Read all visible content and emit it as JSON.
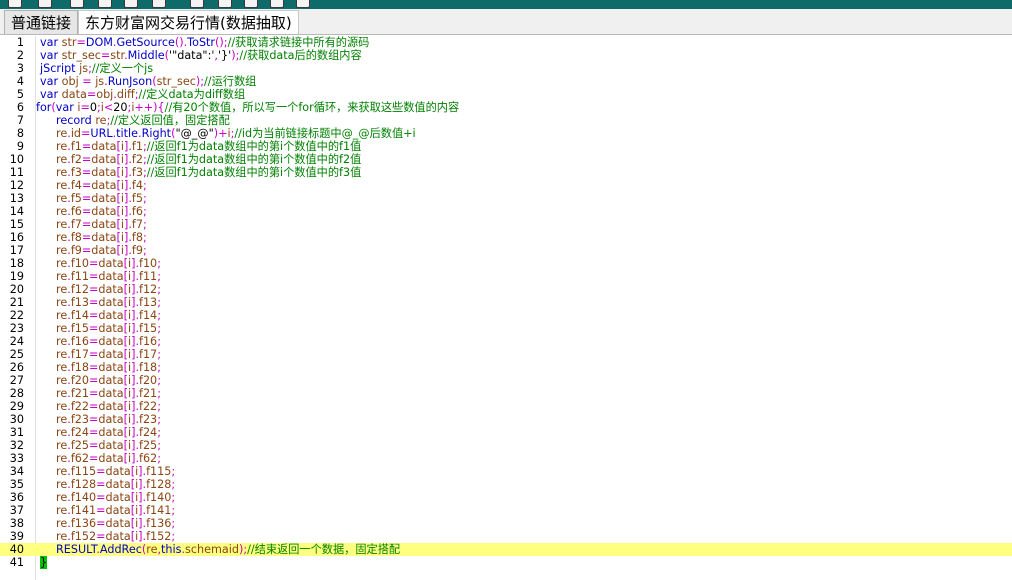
{
  "tabs": [
    {
      "label": "普通链接",
      "active": true
    },
    {
      "label": "东方财富网交易行情(数据抽取)",
      "active": false
    }
  ],
  "toolbar_icons": [
    "save-icon",
    "undo-icon",
    "new-icon",
    "copy-icon",
    "paste-icon",
    "print-icon",
    "run-icon",
    "clipboard-icon",
    "link-icon",
    "brace-icon",
    "export-icon"
  ],
  "colors": {
    "toolbar": "#0f6a6a",
    "highlight_line": "#ffff80",
    "keyword": "#0000c8",
    "comment": "#008000"
  },
  "highlighted_line": 40,
  "lines": [
    {
      "n": "1",
      "text": "var str=DOM.GetSource().ToStr();//获取请求链接中所有的源码"
    },
    {
      "n": "2",
      "text": "var str_sec=str.Middle('\"data\":','}');//获取data后的数组内容"
    },
    {
      "n": "3",
      "text": "jScript js;//定义一个js"
    },
    {
      "n": "4",
      "text": "var obj = js.RunJson(str_sec);//运行数组"
    },
    {
      "n": "5",
      "text": "var data=obj.diff;//定义data为diff数组"
    },
    {
      "n": "6",
      "text": "for(var i=0;i<20;i++){//有20个数值，所以写一个for循环，来获取这些数值的内容"
    },
    {
      "n": "7",
      "text": "record re;//定义返回值，固定搭配"
    },
    {
      "n": "8",
      "text": "re.id=URL.title.Right(\"@_@\")+i;//id为当前链接标题中@_@后数值+i"
    },
    {
      "n": "9",
      "text": "re.f1=data[i].f1;//返回f1为data数组中的第i个数值中的f1值"
    },
    {
      "n": "10",
      "text": "re.f2=data[i].f2;//返回f1为data数组中的第i个数值中的f2值"
    },
    {
      "n": "11",
      "text": "re.f3=data[i].f3;//返回f1为data数组中的第i个数值中的f3值"
    },
    {
      "n": "12",
      "text": "re.f4=data[i].f4;"
    },
    {
      "n": "13",
      "text": "re.f5=data[i].f5;"
    },
    {
      "n": "14",
      "text": "re.f6=data[i].f6;"
    },
    {
      "n": "15",
      "text": "re.f7=data[i].f7;"
    },
    {
      "n": "16",
      "text": "re.f8=data[i].f8;"
    },
    {
      "n": "17",
      "text": "re.f9=data[i].f9;"
    },
    {
      "n": "18",
      "text": "re.f10=data[i].f10;"
    },
    {
      "n": "19",
      "text": "re.f11=data[i].f11;"
    },
    {
      "n": "20",
      "text": "re.f12=data[i].f12;"
    },
    {
      "n": "21",
      "text": "re.f13=data[i].f13;"
    },
    {
      "n": "22",
      "text": "re.f14=data[i].f14;"
    },
    {
      "n": "23",
      "text": "re.f15=data[i].f15;"
    },
    {
      "n": "24",
      "text": "re.f16=data[i].f16;"
    },
    {
      "n": "25",
      "text": "re.f17=data[i].f17;"
    },
    {
      "n": "26",
      "text": "re.f18=data[i].f18;"
    },
    {
      "n": "27",
      "text": "re.f20=data[i].f20;"
    },
    {
      "n": "28",
      "text": "re.f21=data[i].f21;"
    },
    {
      "n": "29",
      "text": "re.f22=data[i].f22;"
    },
    {
      "n": "30",
      "text": "re.f23=data[i].f23;"
    },
    {
      "n": "31",
      "text": "re.f24=data[i].f24;"
    },
    {
      "n": "32",
      "text": "re.f25=data[i].f25;"
    },
    {
      "n": "33",
      "text": "re.f62=data[i].f62;"
    },
    {
      "n": "34",
      "text": "re.f115=data[i].f115;"
    },
    {
      "n": "35",
      "text": "re.f128=data[i].f128;"
    },
    {
      "n": "36",
      "text": "re.f140=data[i].f140;"
    },
    {
      "n": "37",
      "text": "re.f141=data[i].f141;"
    },
    {
      "n": "38",
      "text": "re.f136=data[i].f136;"
    },
    {
      "n": "39",
      "text": "re.f152=data[i].f152;"
    },
    {
      "n": "40",
      "text": "RESULT.AddRec(re,this.schemaid);//结束返回一个数据，固定搭配"
    },
    {
      "n": "41",
      "text": "}"
    }
  ]
}
